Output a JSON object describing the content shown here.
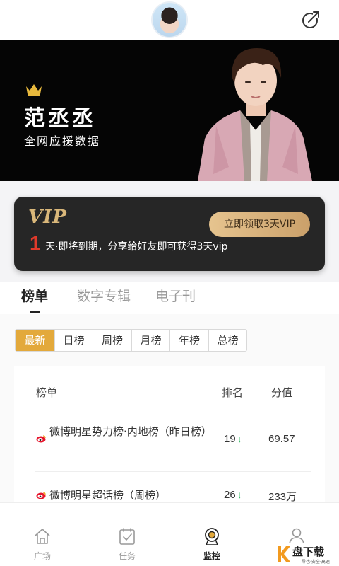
{
  "header": {
    "avatar_icon": "avatar-icon",
    "share_icon": "share-icon"
  },
  "hero": {
    "name": "范丞丞",
    "subtitle": "全网应援数据",
    "crown_icon": "crown-icon"
  },
  "vip": {
    "logo": "VIP",
    "button": "立即领取3天VIP",
    "days": "1",
    "message": "天·即将到期，分享给好友即可获得3天vip",
    "accent": "#d9b77a"
  },
  "tabs": [
    {
      "label": "榜单",
      "active": true
    },
    {
      "label": "数字专辑",
      "active": false
    },
    {
      "label": "电子刊",
      "active": false
    }
  ],
  "filters": [
    {
      "label": "最新",
      "active": true
    },
    {
      "label": "日榜"
    },
    {
      "label": "周榜"
    },
    {
      "label": "月榜"
    },
    {
      "label": "年榜"
    },
    {
      "label": "总榜"
    }
  ],
  "table": {
    "headers": {
      "name": "榜单",
      "rank": "排名",
      "score": "分值"
    },
    "rows": [
      {
        "name": "微博明星势力榜·内地榜（昨日榜）",
        "rank": "19",
        "trend": "↓",
        "score": "69.57"
      },
      {
        "name": "微博明星超话榜（周榜）",
        "rank": "26",
        "trend": "↓",
        "score": "233万"
      }
    ]
  },
  "nav": [
    {
      "label": "广场",
      "icon": "home-icon",
      "active": false
    },
    {
      "label": "任务",
      "icon": "task-icon",
      "active": false
    },
    {
      "label": "监控",
      "icon": "monitor-icon",
      "active": true
    },
    {
      "label": "",
      "icon": "user-icon",
      "active": false
    }
  ],
  "watermark": {
    "text": "盘下载",
    "small": "导也·安全·高速"
  }
}
